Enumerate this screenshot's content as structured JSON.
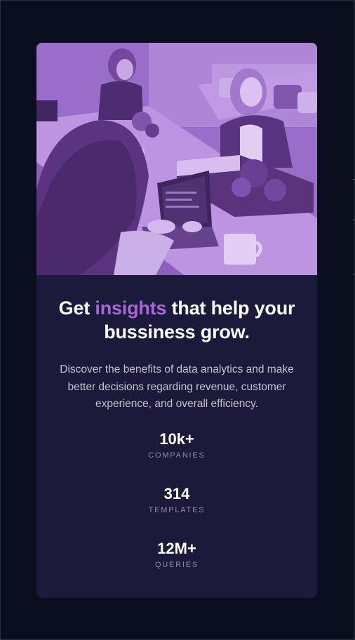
{
  "card": {
    "image_alt": "People working on laptops at an office desk",
    "headline_prefix": "Get",
    "headline_accent": "insights",
    "headline_suffix": "that help your bussiness grow.",
    "description": "Discover the benefits of data analytics and make better decisions regarding revenue, customer experience, and overall efficiency.",
    "stats": [
      {
        "value": "10k+",
        "label": "COMPANIES"
      },
      {
        "value": "314",
        "label": "TEMPLATES"
      },
      {
        "value": "12M+",
        "label": "QUERIES"
      }
    ]
  },
  "colors": {
    "page_background": "#0b0e1e",
    "card_background": "#1c1a3a",
    "accent": "#a966d7",
    "image_tint": "#9b72c9",
    "text_primary": "#ffffff",
    "text_secondary": "#c4c2d6",
    "text_muted": "#8f8ca8"
  }
}
